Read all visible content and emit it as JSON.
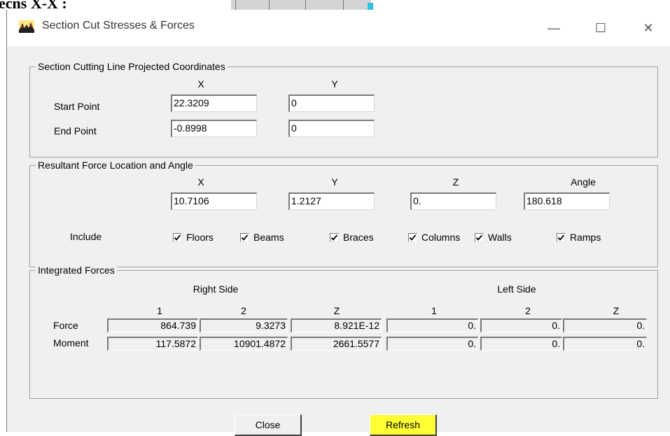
{
  "background": {
    "heading": "ecns X-X :"
  },
  "window": {
    "title": "Section Cut Stresses & Forces",
    "icon": "app-mountain-icon",
    "controls": {
      "minimize": "—",
      "maximize": "☐",
      "close": "✕"
    }
  },
  "cutting_line": {
    "legend": "Section Cutting Line Projected Coordinates",
    "col_x": "X",
    "col_y": "Y",
    "rows": [
      {
        "label": "Start Point",
        "x": "22.3209",
        "y": "0"
      },
      {
        "label": "End Point",
        "x": "-0.8998",
        "y": "0"
      }
    ]
  },
  "resultant": {
    "legend": "Resultant Force Location and Angle",
    "headers": [
      "X",
      "Y",
      "Z",
      "Angle"
    ],
    "values": [
      "10.7106",
      "1.2127",
      "0.",
      "180.618"
    ],
    "include_label": "Include",
    "checkboxes": [
      {
        "label": "Floors",
        "checked": true
      },
      {
        "label": "Beams",
        "checked": true
      },
      {
        "label": "Braces",
        "checked": true
      },
      {
        "label": "Columns",
        "checked": true
      },
      {
        "label": "Walls",
        "checked": true
      },
      {
        "label": "Ramps",
        "checked": true
      }
    ]
  },
  "integrated": {
    "legend": "Integrated Forces",
    "right_side": "Right Side",
    "left_side": "Left Side",
    "col_headers": [
      "1",
      "2",
      "Z",
      "1",
      "2",
      "Z"
    ],
    "rows": [
      {
        "label": "Force",
        "values": [
          "864.739",
          "9.3273",
          "8.921E-12",
          "0.",
          "0.",
          "0."
        ]
      },
      {
        "label": "Moment",
        "values": [
          "117.5872",
          "10901.4872",
          "2661.5577",
          "0.",
          "0.",
          "0."
        ]
      }
    ]
  },
  "buttons": {
    "close": "Close",
    "refresh": "Refresh",
    "highlight": "#ffff33"
  }
}
